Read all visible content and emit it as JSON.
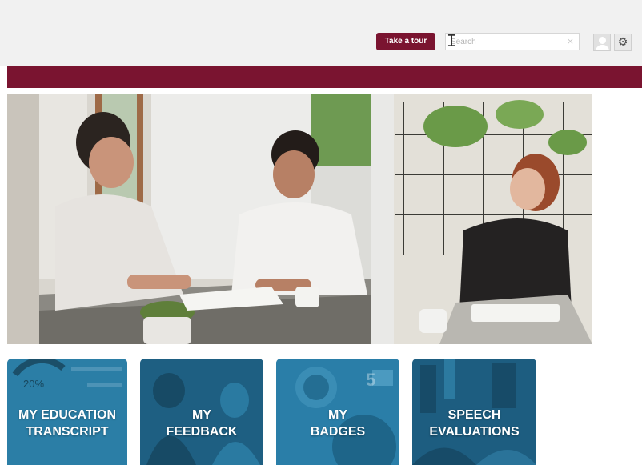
{
  "header": {
    "tour_button": "Take a tour",
    "search_placeholder": "Search",
    "search_clear": "×",
    "settings_icon": "gear-icon",
    "avatar_icon": "user-icon"
  },
  "colors": {
    "accent": "#7a1430",
    "tile_blue": "#1f6f95",
    "topbar_bg": "#f1f1f1"
  },
  "tiles": [
    {
      "line1": "MY EDUCATION",
      "line2": "TRANSCRIPT",
      "badge": "20%"
    },
    {
      "line1": "MY",
      "line2": "FEEDBACK"
    },
    {
      "line1": "MY",
      "line2": "BADGES",
      "badge": "5"
    },
    {
      "line1": "SPEECH",
      "line2": "EVALUATIONS"
    }
  ]
}
